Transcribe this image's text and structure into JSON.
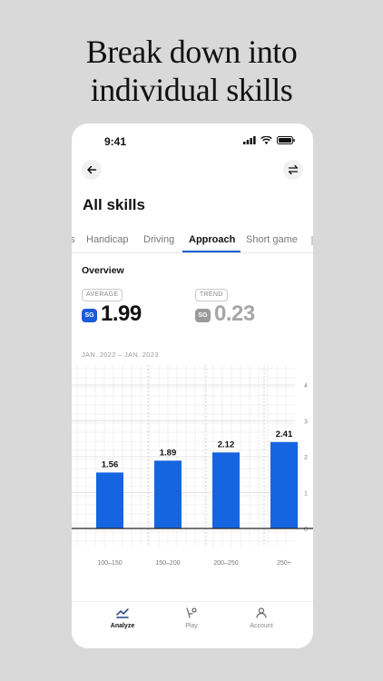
{
  "headline": {
    "line1": "Break down into",
    "line2": "individual skills"
  },
  "status": {
    "time": "9:41"
  },
  "page": {
    "title": "All skills"
  },
  "tabs": [
    {
      "label": "s"
    },
    {
      "label": "Handicap"
    },
    {
      "label": "Driving"
    },
    {
      "label": "Approach"
    },
    {
      "label": "Short game"
    }
  ],
  "active_tab": "Approach",
  "overview": {
    "title": "Overview",
    "average_label": "AVERAGE",
    "average_badge": "SG",
    "average_value": "1.99",
    "trend_label": "TREND",
    "trend_badge": "SG",
    "trend_value": "0.23",
    "date_range": "JAN. 2022 – JAN. 2023"
  },
  "colors": {
    "accent": "#1a5bd6",
    "bar": "#1565e0",
    "muted_badge": "#9a9a9a"
  },
  "chart_data": {
    "type": "bar",
    "categories": [
      "100–150",
      "150–200",
      "200–250",
      "250+"
    ],
    "values": [
      1.56,
      1.89,
      2.12,
      2.41
    ],
    "value_labels": [
      "1.56",
      "1.89",
      "2.12",
      "2.41"
    ],
    "ylim": [
      0,
      4
    ],
    "yticks": [
      "0",
      "1",
      "2",
      "3",
      "4"
    ],
    "grid": true,
    "title": "",
    "xlabel": "",
    "ylabel": ""
  },
  "bottom_nav": [
    {
      "label": "Analyze",
      "icon": "trend-chart-icon",
      "active": true
    },
    {
      "label": "Play",
      "icon": "golf-tee-icon",
      "active": false
    },
    {
      "label": "Account",
      "icon": "person-icon",
      "active": false
    }
  ]
}
